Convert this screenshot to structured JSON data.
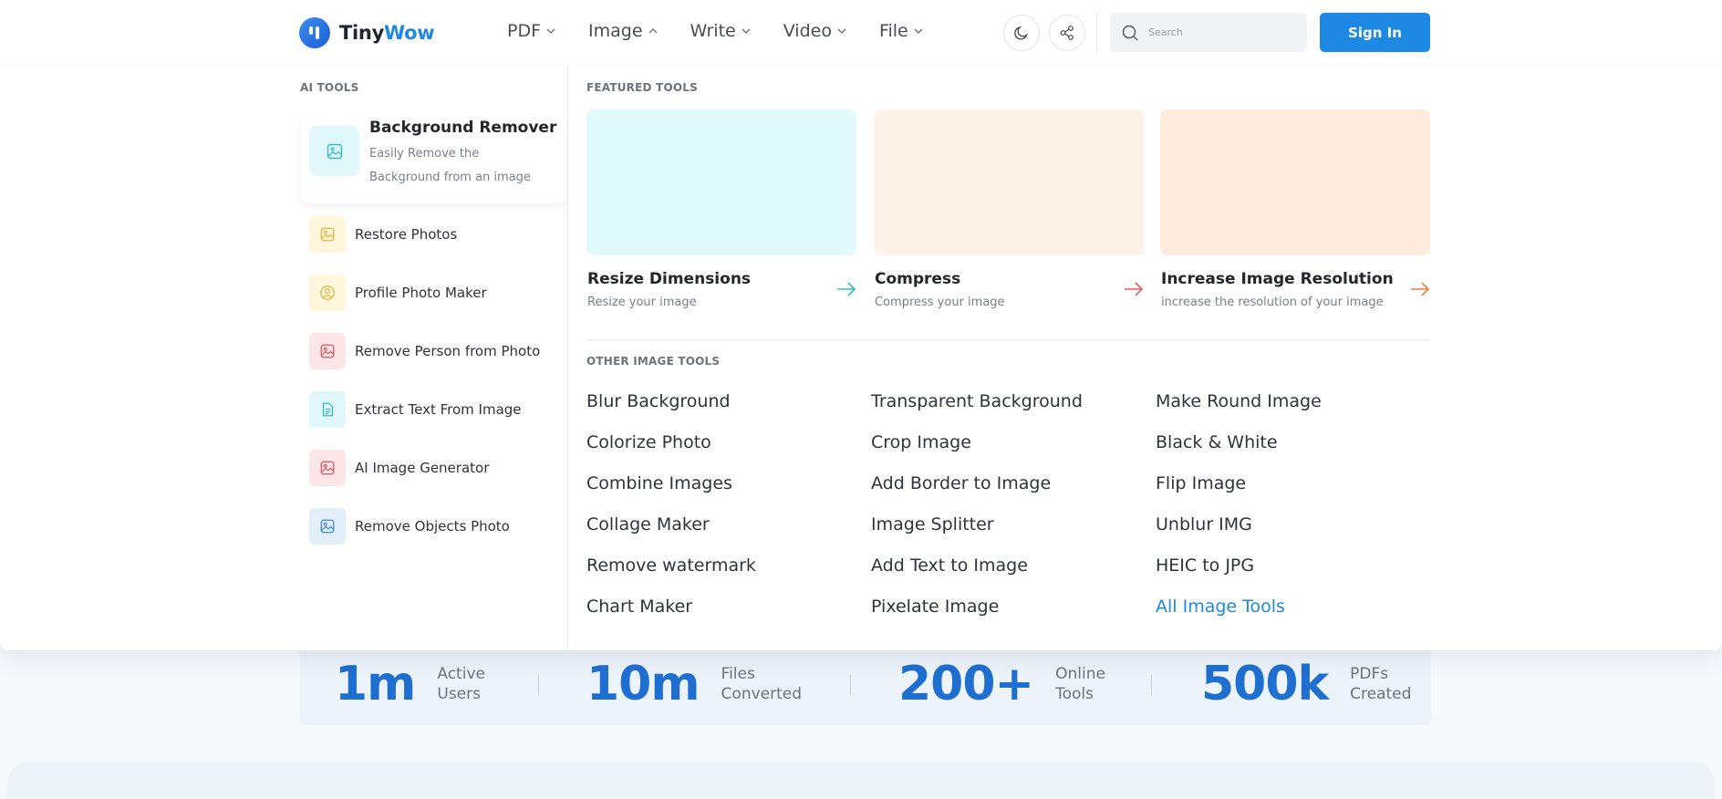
{
  "brand": {
    "name_part1": "Tiny",
    "name_part2": "Wow",
    "accent": "#1e88e5"
  },
  "nav": {
    "items": [
      {
        "label": "PDF",
        "state": "collapsed"
      },
      {
        "label": "Image",
        "state": "expanded"
      },
      {
        "label": "Write",
        "state": "collapsed"
      },
      {
        "label": "Video",
        "state": "collapsed"
      },
      {
        "label": "File",
        "state": "collapsed"
      }
    ]
  },
  "header": {
    "theme_icon": "moon-icon",
    "share_icon": "share-icon",
    "search_placeholder": "Search",
    "signin_label": "Sign In"
  },
  "mega_menu": {
    "ai_tools_title": "AI TOOLS",
    "ai_featured": {
      "title": "Background Remover",
      "description": "Easily Remove the Background from an image",
      "icon": "image-icon",
      "icon_bg": "#e1f8fa",
      "icon_color": "#35b9c9"
    },
    "ai_items": [
      {
        "label": "Restore Photos",
        "icon": "image-icon",
        "bg": "#fff6dc",
        "color": "#e0b43a"
      },
      {
        "label": "Profile Photo Maker",
        "icon": "user-circle-icon",
        "bg": "#fff6dc",
        "color": "#e0b43a"
      },
      {
        "label": "Remove Person from Photo",
        "icon": "image-icon",
        "bg": "#fde6e8",
        "color": "#e0505d"
      },
      {
        "label": "Extract Text From Image",
        "icon": "document-icon",
        "bg": "#e1f8fa",
        "color": "#35b9c9"
      },
      {
        "label": "AI Image Generator",
        "icon": "image-icon",
        "bg": "#fde6e8",
        "color": "#e0505d"
      },
      {
        "label": "Remove Objects Photo",
        "icon": "image-icon",
        "bg": "#e3eefb",
        "color": "#3f86d9"
      }
    ],
    "featured_title": "FEATURED TOOLS",
    "featured": [
      {
        "title": "Resize Dimensions",
        "description": "Resize your image",
        "thumb_color": "#e1fafc",
        "arrow_color": "#35b9c9"
      },
      {
        "title": "Compress",
        "description": "Compress your image",
        "thumb_color": "#fdf3e9",
        "arrow_color": "#ef5a5a"
      },
      {
        "title": "Increase Image Resolution",
        "description": "increase the resolution of your image",
        "thumb_color": "#fdeadc",
        "arrow_color": "#f07a3a"
      }
    ],
    "other_title": "OTHER IMAGE TOOLS",
    "other_tools": [
      [
        "Blur Background",
        "Transparent Background",
        "Make Round Image"
      ],
      [
        "Colorize Photo",
        "Crop Image",
        "Black & White"
      ],
      [
        "Combine Images",
        "Add Border to Image",
        "Flip Image"
      ],
      [
        "Collage Maker",
        "Image Splitter",
        "Unblur IMG"
      ],
      [
        "Remove watermark",
        "Add Text to Image",
        "HEIC to JPG"
      ],
      [
        "Chart Maker",
        "Pixelate Image",
        "All Image Tools"
      ]
    ]
  },
  "stats": [
    {
      "value": "1m",
      "label_line1": "Active",
      "label_line2": "Users"
    },
    {
      "value": "10m",
      "label_line1": "Files",
      "label_line2": "Converted"
    },
    {
      "value": "200+",
      "label_line1": "Online",
      "label_line2": "Tools"
    },
    {
      "value": "500k",
      "label_line1": "PDFs",
      "label_line2": "Created"
    }
  ]
}
